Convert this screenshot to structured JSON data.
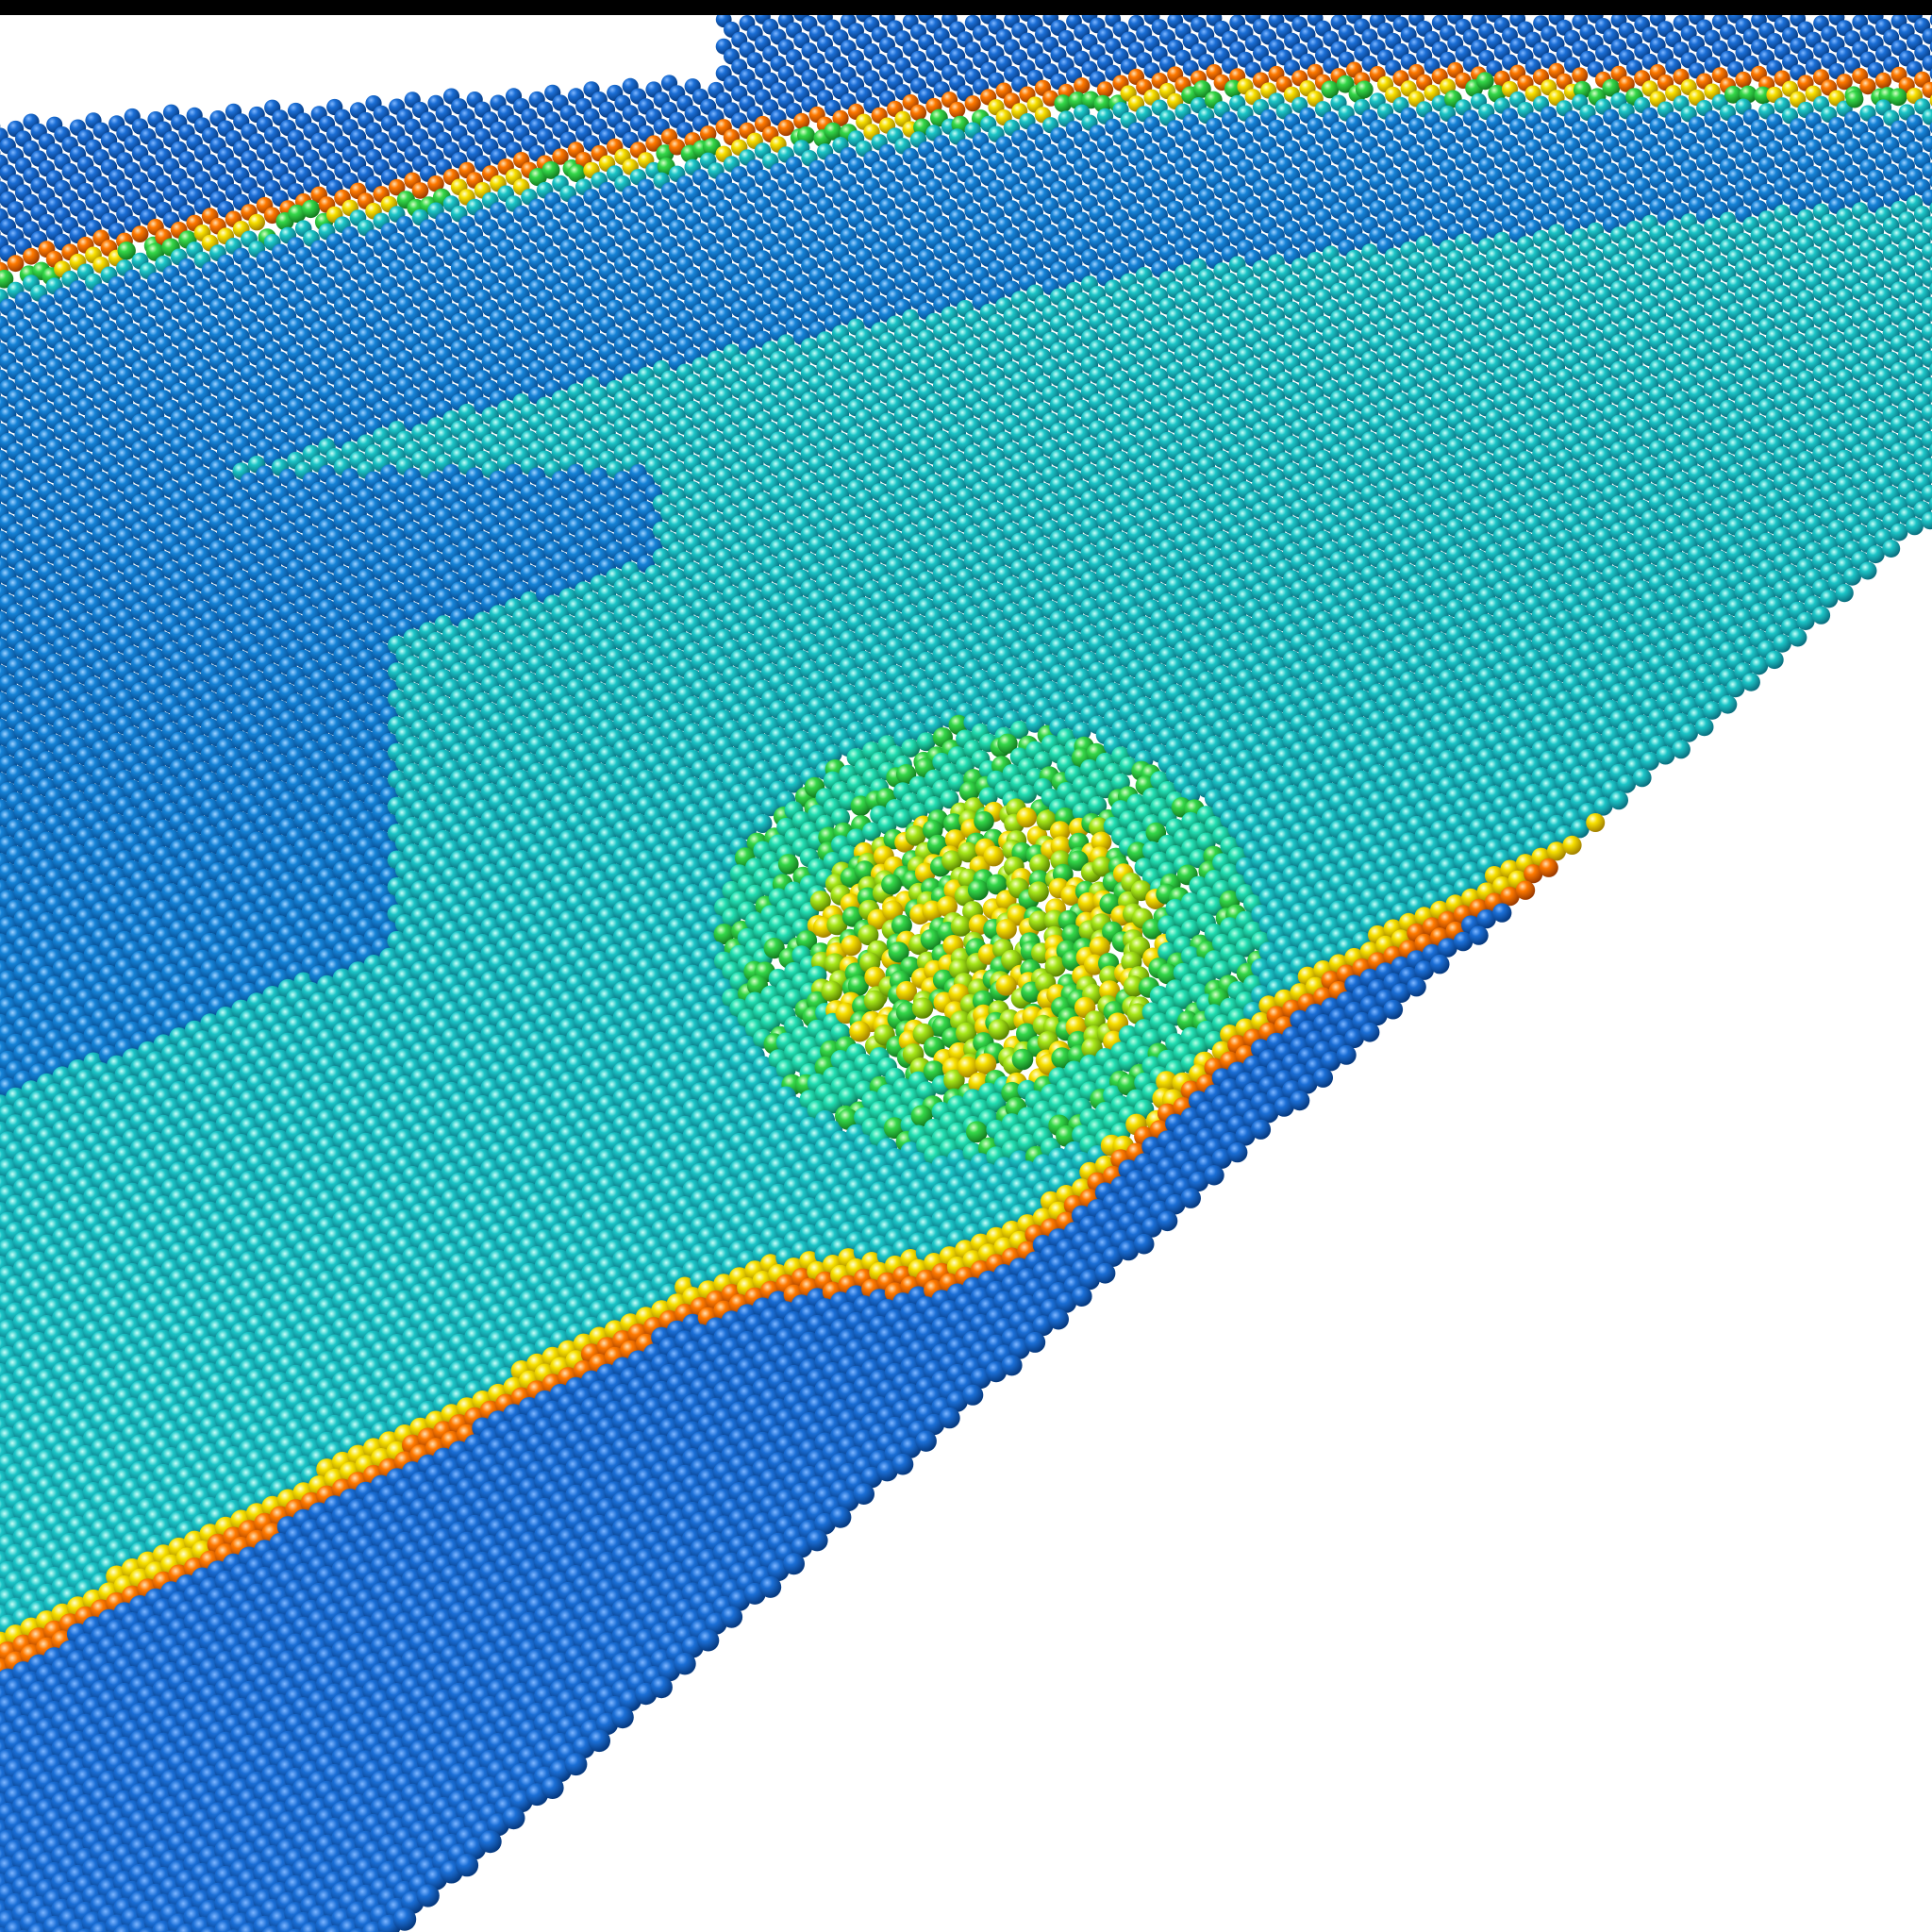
{
  "figure": {
    "kind": "atomistic-simulation-rendering",
    "description_colors": {
      "background": "#ffffff",
      "frame_top_bar": "#000000",
      "color_scale": [
        "#0a4fb4",
        "#1173cf",
        "#18b7c8",
        "#1ee0b8",
        "#2bd85a",
        "#9be81a",
        "#f2e400",
        "#ffc400",
        "#ff7a00"
      ],
      "bulk": "#0b5fc2",
      "surface": "#17b8c9",
      "step_edge_inner": "#ffd400",
      "step_edge_outer": "#ff7400",
      "defect_core": "#43d84a"
    },
    "features": [
      "atomic-lattice-surface",
      "upper-step-edge",
      "lower-step-edge",
      "defect-cluster"
    ]
  }
}
